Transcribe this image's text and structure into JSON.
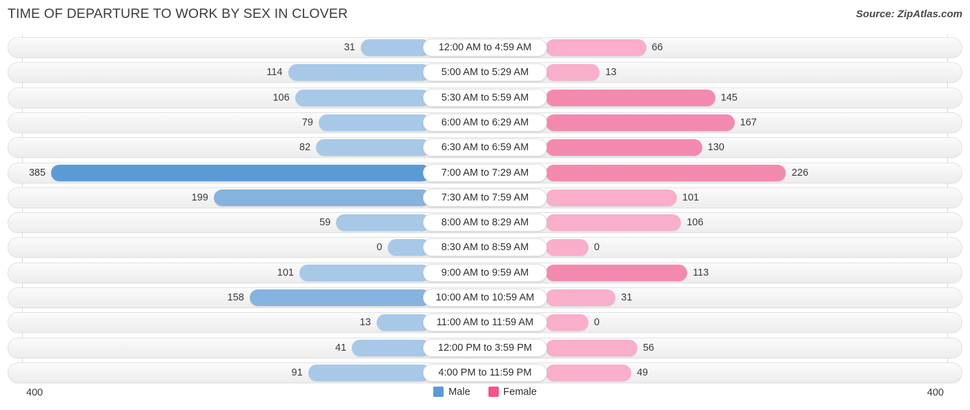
{
  "header": {
    "title": "TIME OF DEPARTURE TO WORK BY SEX IN CLOVER",
    "source": "Source: ZipAtlas.com"
  },
  "axis": {
    "left_max": "400",
    "right_max": "400",
    "max_value": 400
  },
  "legend": {
    "items": [
      {
        "label": "Male",
        "color": "#5b9bd5"
      },
      {
        "label": "Female",
        "color": "#f4558c"
      }
    ]
  },
  "colors": {
    "male_light": "#a8c8e8",
    "male_mid": "#86b2de",
    "male_strong": "#5b9bd5",
    "female_light": "#f9aecb",
    "female_mid": "#f489b0",
    "female_strong": "#f4558c",
    "track": "#f3f3f3",
    "gridline": "#d7d7d7"
  },
  "chart_data": {
    "type": "bar",
    "subtype": "diverging-bidirectional",
    "title": "Time of Departure to Work by Sex in Clover",
    "xlabel": "",
    "ylabel": "",
    "xlim": [
      400,
      400
    ],
    "grid": true,
    "legend_position": "bottom-center",
    "categories": [
      "12:00 AM to 4:59 AM",
      "5:00 AM to 5:29 AM",
      "5:30 AM to 5:59 AM",
      "6:00 AM to 6:29 AM",
      "6:30 AM to 6:59 AM",
      "7:00 AM to 7:29 AM",
      "7:30 AM to 7:59 AM",
      "8:00 AM to 8:29 AM",
      "8:30 AM to 8:59 AM",
      "9:00 AM to 9:59 AM",
      "10:00 AM to 10:59 AM",
      "11:00 AM to 11:59 AM",
      "12:00 PM to 3:59 PM",
      "4:00 PM to 11:59 PM"
    ],
    "series": [
      {
        "name": "Male",
        "direction": "left",
        "color": "#5b9bd5",
        "values": [
          31,
          114,
          106,
          79,
          82,
          385,
          199,
          59,
          0,
          101,
          158,
          13,
          41,
          91
        ]
      },
      {
        "name": "Female",
        "direction": "right",
        "color": "#f4558c",
        "values": [
          66,
          13,
          145,
          167,
          130,
          226,
          101,
          106,
          0,
          113,
          31,
          0,
          56,
          49
        ]
      }
    ]
  },
  "rows": [
    {
      "label": "12:00 AM to 4:59 AM",
      "male": "31",
      "female": "66"
    },
    {
      "label": "5:00 AM to 5:29 AM",
      "male": "114",
      "female": "13"
    },
    {
      "label": "5:30 AM to 5:59 AM",
      "male": "106",
      "female": "145"
    },
    {
      "label": "6:00 AM to 6:29 AM",
      "male": "79",
      "female": "167"
    },
    {
      "label": "6:30 AM to 6:59 AM",
      "male": "82",
      "female": "130"
    },
    {
      "label": "7:00 AM to 7:29 AM",
      "male": "385",
      "female": "226"
    },
    {
      "label": "7:30 AM to 7:59 AM",
      "male": "199",
      "female": "101"
    },
    {
      "label": "8:00 AM to 8:29 AM",
      "male": "59",
      "female": "106"
    },
    {
      "label": "8:30 AM to 8:59 AM",
      "male": "0",
      "female": "0"
    },
    {
      "label": "9:00 AM to 9:59 AM",
      "male": "101",
      "female": "113"
    },
    {
      "label": "10:00 AM to 10:59 AM",
      "male": "158",
      "female": "31"
    },
    {
      "label": "11:00 AM to 11:59 AM",
      "male": "13",
      "female": "0"
    },
    {
      "label": "12:00 PM to 3:59 PM",
      "male": "41",
      "female": "56"
    },
    {
      "label": "4:00 PM to 11:59 PM",
      "male": "91",
      "female": "49"
    }
  ]
}
